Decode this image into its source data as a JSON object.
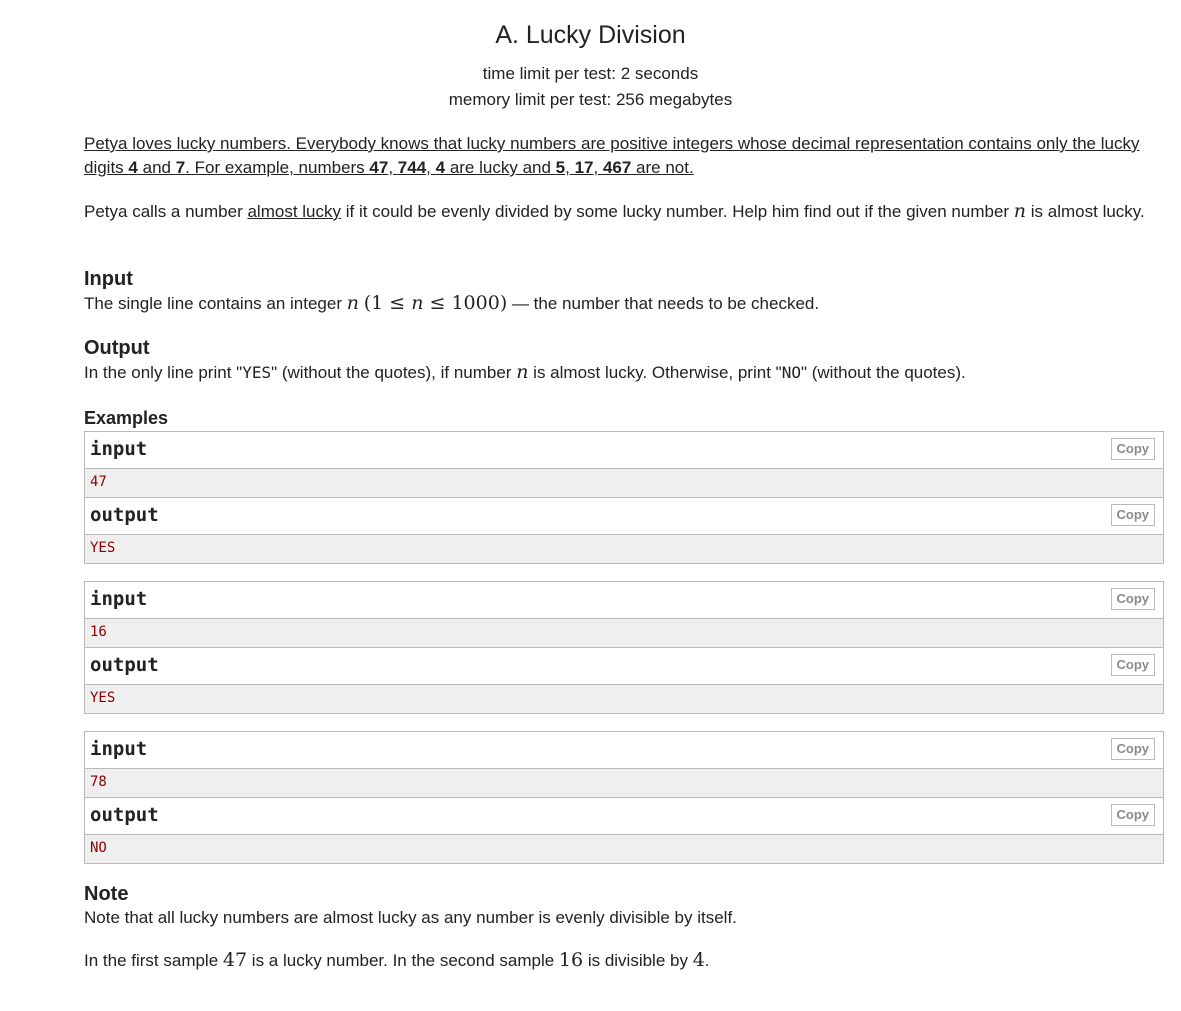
{
  "problem": {
    "title": "A. Lucky Division",
    "time_limit": "time limit per test: 2 seconds",
    "memory_limit": "memory limit per test: 256 megabytes"
  },
  "statement": {
    "p1_a": "Petya loves lucky numbers. Everybody knows that lucky numbers are positive integers whose decimal representation contains only the lucky digits ",
    "p1_d4": "4",
    "p1_and": " and ",
    "p1_d7": "7",
    "p1_b": ". For example, numbers ",
    "p1_n47": "47",
    "p1_c1": ", ",
    "p1_n744": "744",
    "p1_c2": ", ",
    "p1_n4": "4",
    "p1_c": " are lucky and ",
    "p1_n5": "5",
    "p1_c3": ", ",
    "p1_n17": "17",
    "p1_c4": ", ",
    "p1_n467": "467",
    "p1_d": " are not.",
    "p2_a": "Petya calls a number ",
    "p2_al": "almost lucky",
    "p2_b": " if it could be evenly divided by some lucky number. Help him find out if the given number ",
    "p2_n": "n",
    "p2_c": " is almost lucky."
  },
  "input_section": {
    "title": "Input",
    "text_a": "The single line contains an integer ",
    "var_n": "n",
    "constraint": "(1 ≤ ",
    "var_n2": "n",
    "constraint_b": " ≤ 1000)",
    "text_b": " — the number that needs to be checked."
  },
  "output_section": {
    "title": "Output",
    "text_a": "In the only line print \"",
    "yes": "YES",
    "text_b": "\" (without the quotes), if number ",
    "var_n": "n",
    "text_c": " is almost lucky. Otherwise, print \"",
    "no": "NO",
    "text_d": "\" (without the quotes)."
  },
  "examples": {
    "title": "Examples",
    "input_label": "input",
    "output_label": "output",
    "copy_label": "Copy",
    "items": [
      {
        "input": "47",
        "output": "YES"
      },
      {
        "input": "16",
        "output": "YES"
      },
      {
        "input": "78",
        "output": "NO"
      }
    ]
  },
  "note": {
    "title": "Note",
    "p1": "Note that all lucky numbers are almost lucky as any number is evenly divisible by itself.",
    "p2_a": "In the first sample ",
    "p2_n47": "47",
    "p2_b": " is a lucky number. In the second sample ",
    "p2_n16": "16",
    "p2_c": " is divisible by ",
    "p2_n4": "4",
    "p2_d": "."
  }
}
